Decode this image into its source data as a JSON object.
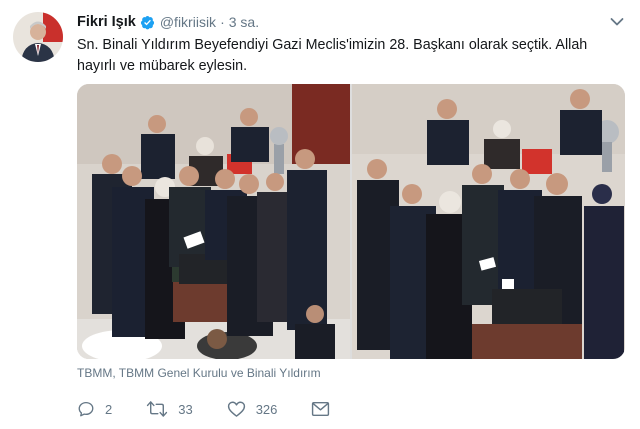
{
  "tweet": {
    "author_name": "Fikri Işık",
    "handle": "@fikriisik",
    "separator": "·",
    "time": "3 sa.",
    "text": "Sn. Binali Yıldırım Beyefendiyi Gazi Meclis'imizin 28. Başkanı olarak seçtik. Allah hayırlı ve mübarek eylesin.",
    "tags": "TBMM, TBMM Genel Kurulu ve Binali Yıldırım"
  },
  "actions": {
    "reply_count": "2",
    "retweet_count": "33",
    "like_count": "326"
  },
  "colors": {
    "text": "#14171a",
    "muted": "#657786",
    "verified": "#1da1f2"
  },
  "icons": [
    "verified-badge-icon",
    "caret-down-icon",
    "reply-icon",
    "retweet-icon",
    "like-icon",
    "direct-message-icon"
  ]
}
